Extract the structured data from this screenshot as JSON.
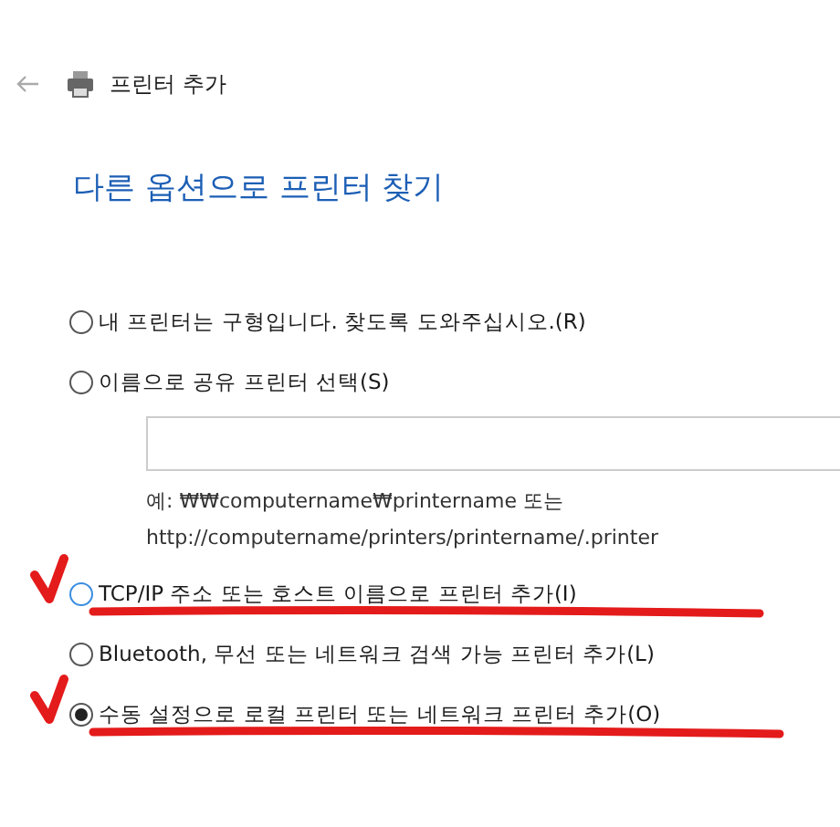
{
  "header": {
    "title": "프린터 추가"
  },
  "heading": "다른 옵션으로 프린터 찾기",
  "options": [
    {
      "kind": "plain",
      "label": "내 프린터는 구형입니다. 찾도록 도와주십시오.(R)",
      "selected": false,
      "color": "#555555",
      "annotated": false
    },
    {
      "kind": "with-field",
      "label": "이름으로 공유 프린터 선택(S)",
      "selected": false,
      "color": "#555555",
      "annotated": false,
      "hint": [
        "예: ₩₩computername₩printername 또는",
        "http://computername/printers/printername/.printer"
      ]
    },
    {
      "kind": "plain",
      "label": "TCP/IP 주소 또는 호스트 이름으로 프린터 추가(I)",
      "selected": false,
      "color": "#3b8de0",
      "annotated": true
    },
    {
      "kind": "plain",
      "label": "Bluetooth, 무선 또는 네트워크 검색 가능 프린터 추가(L)",
      "selected": false,
      "color": "#555555",
      "annotated": false
    },
    {
      "kind": "plain",
      "label": "수동 설정으로 로컬 프린터 또는 네트워크 프린터 추가(O)",
      "selected": true,
      "color": "#555555",
      "annotated": true
    }
  ]
}
